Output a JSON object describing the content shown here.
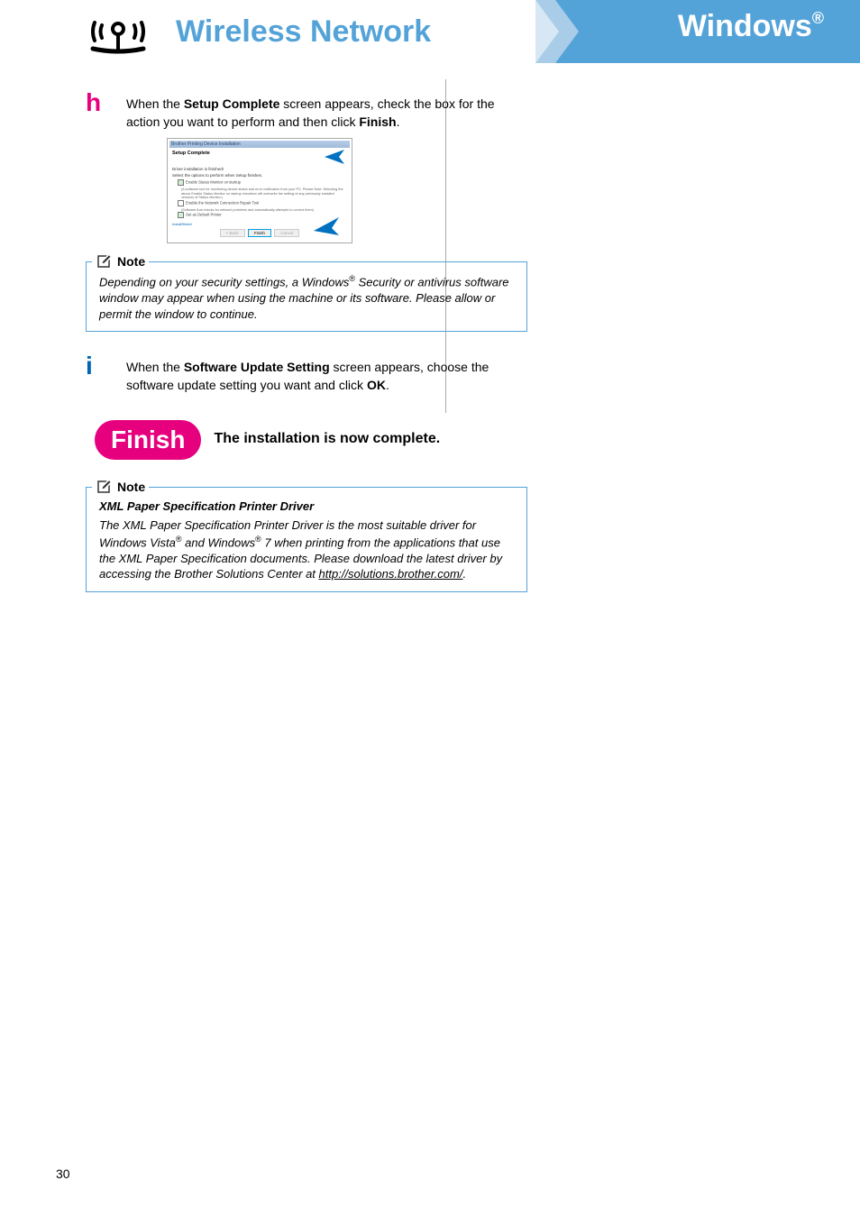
{
  "header": {
    "title": "Wireless Network",
    "platform": "Windows",
    "reg": "®"
  },
  "step_h": {
    "letter": "h",
    "text_parts": [
      "When the ",
      "Setup Complete",
      " screen appears, check the box for the action you want to perform and then click ",
      "Finish",
      "."
    ]
  },
  "dialog": {
    "titlebar": "Brother Printing Device Installation",
    "heading": "Setup Complete",
    "line1": "Driver installation is finished!",
    "line2": "Select the options to perform when Setup finishes.",
    "opt1": "Enable Status Monitor on startup",
    "opt1_sub": "(A software tool for monitoring device status and error notification from your PC. Please Note: Selecting the above Enable Status Monitor on startup checkbox will overwrite the setting of any previously installed versions of Status Monitor.)",
    "opt2": "Enable the Network Connection Repair Tool",
    "opt2_sub": "(Software that checks for network problems and automatically attempts to correct them)",
    "opt3": "Set as Default Printer",
    "shield_label": "InstallShield",
    "btn_back": "< Back",
    "btn_finish": "Finish",
    "btn_cancel": "Cancel"
  },
  "note1": {
    "label": "Note",
    "body": [
      "Depending on your security settings, a Windows",
      "®",
      " Security or antivirus software window may appear when using the machine or its software. Please allow or permit the window to continue."
    ]
  },
  "step_i": {
    "letter": "i",
    "text_parts": [
      "When the ",
      "Software Update Setting",
      " screen appears, choose the software update setting you want and click ",
      "OK",
      "."
    ]
  },
  "finish": {
    "bubble": "Finish",
    "text": "The installation is now complete."
  },
  "note2": {
    "label": "Note",
    "subtitle": "XML Paper Specification Printer Driver",
    "body": [
      "The XML Paper Specification Printer Driver is the most suitable driver for Windows Vista",
      "®",
      " and Windows",
      "®",
      " 7 when printing from the applications that use the XML Paper Specification documents. Please download the latest driver by accessing the Brother Solutions Center at "
    ],
    "url": "http://solutions.brother.com/",
    "period": "."
  },
  "page_number": "30"
}
